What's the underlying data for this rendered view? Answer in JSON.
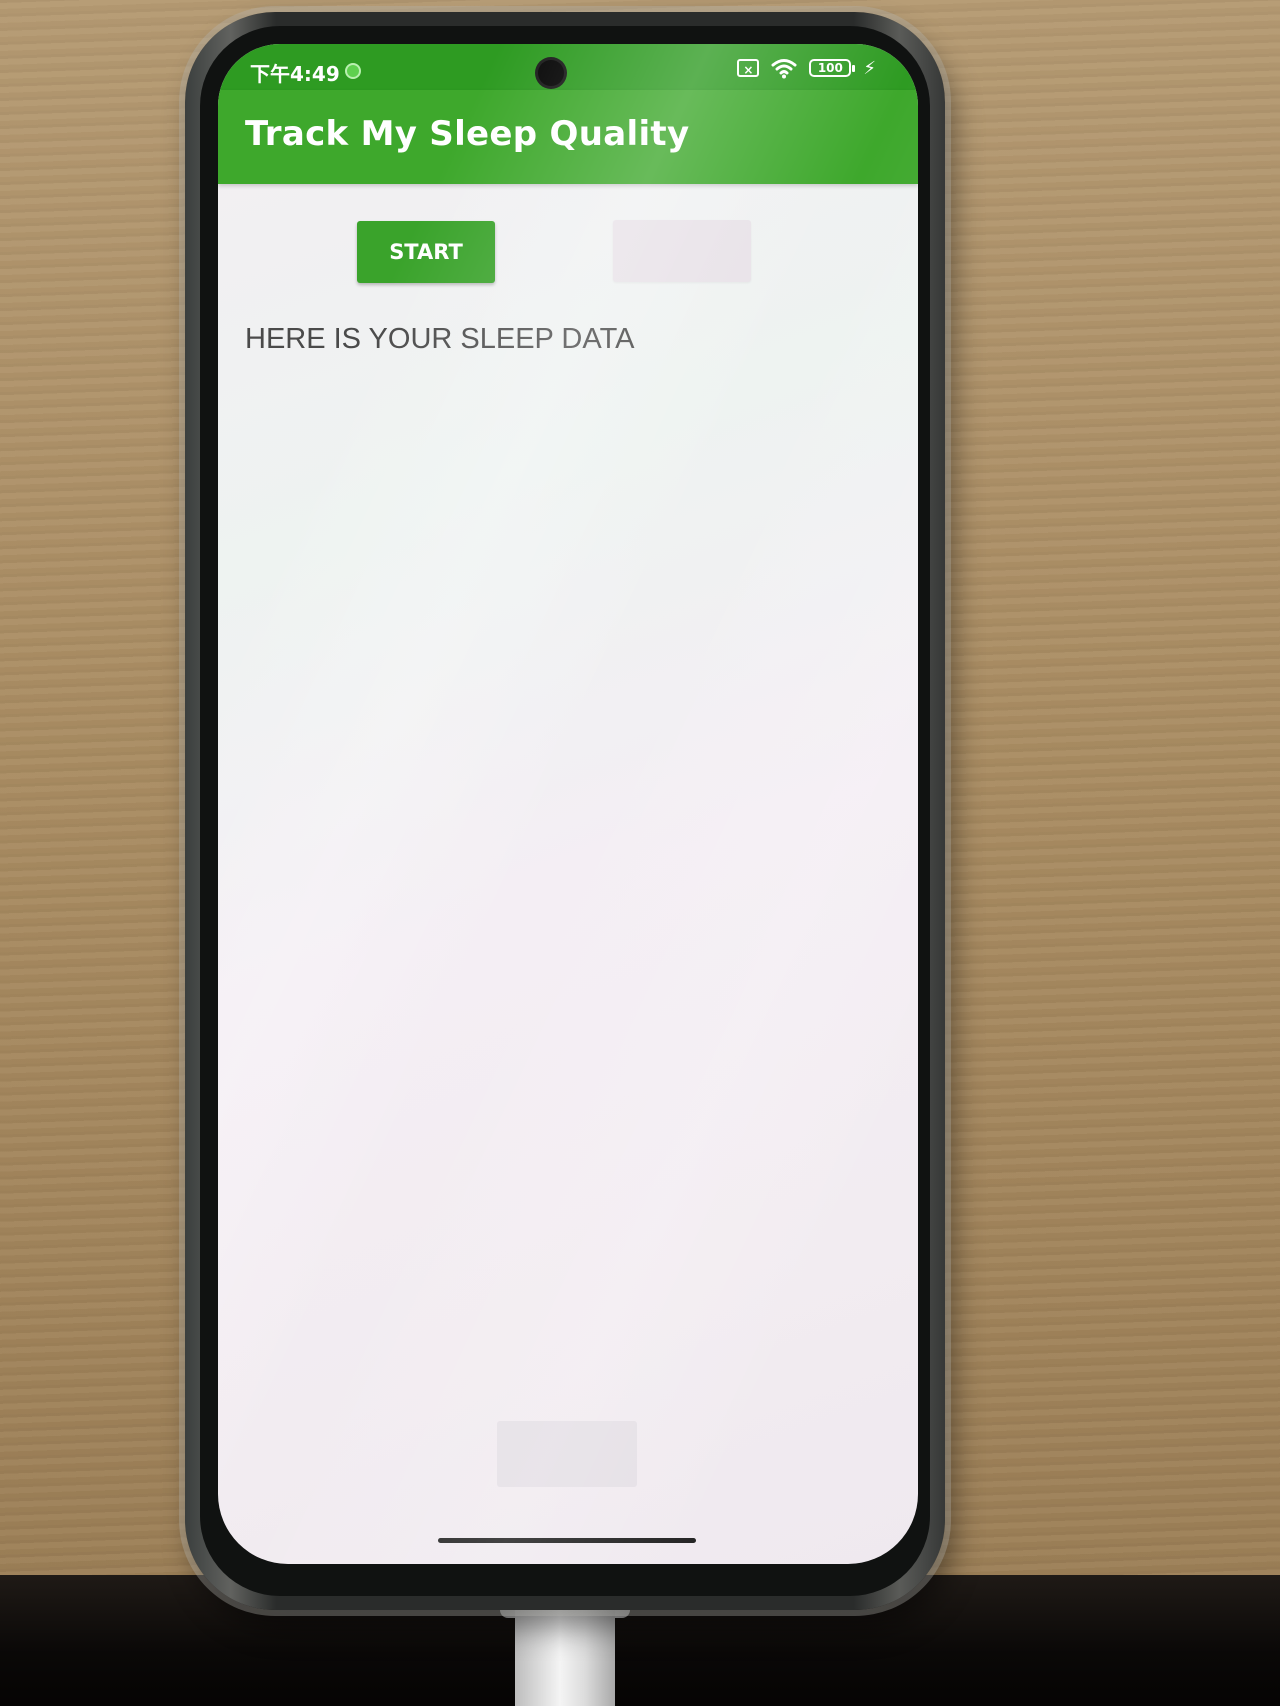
{
  "status_bar": {
    "time": "下午4:49",
    "battery": "100",
    "sim_icon": "x-sim-icon",
    "wifi_icon": "wifi-icon",
    "battery_icon": "battery-icon",
    "charging_icon": "bolt-icon"
  },
  "app_bar": {
    "title": "Track My Sleep Quality"
  },
  "buttons": {
    "start_label": "START",
    "stop_label": "",
    "clear_label": ""
  },
  "content": {
    "sleep_data_text": "HERE IS YOUR SLEEP DATA"
  },
  "colors": {
    "primary": "#3ea82c",
    "status_bar": "#2e9b22",
    "button": "#3aa32b",
    "disabled_button": "#e8e2e8",
    "text": "#4a4a4a"
  }
}
